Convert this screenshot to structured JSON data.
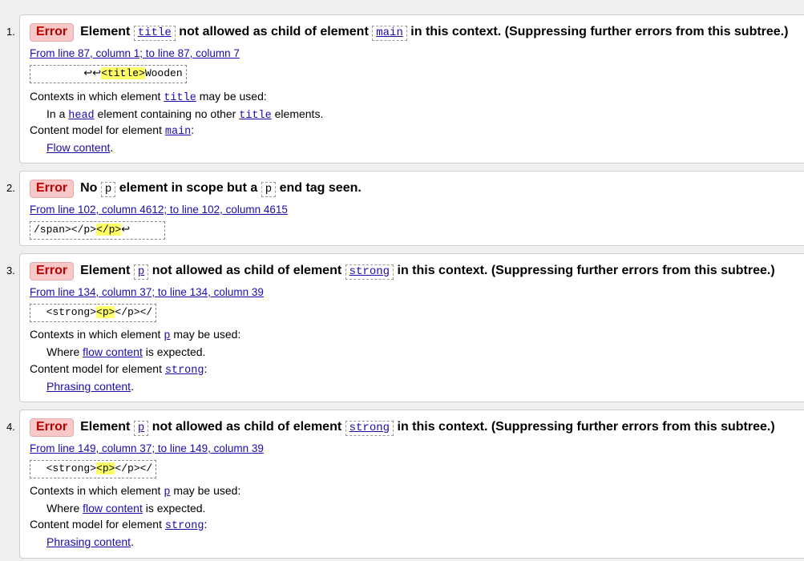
{
  "errors": [
    {
      "num": "1.",
      "badge": "Error",
      "msg": {
        "a": "Element",
        "code1": "title",
        "b": "not allowed as child of element",
        "code2": "main",
        "c": "in this context. (Suppressing further errors from this subtree.)"
      },
      "location": "From line 87, column 1; to line 87, column 7",
      "extract": {
        "pre": "        ↩↩",
        "hl": "<title>",
        "post": "Wooden"
      },
      "ctx_label": {
        "pre": "Contexts in which element",
        "el": "title",
        "post": "may be used:"
      },
      "ctx_value": {
        "pre": "In a",
        "link": "head",
        "post": "element containing no other",
        "el": "title",
        "post2": "elements."
      },
      "cm_label": {
        "pre": "Content model for element",
        "el": "main",
        "post": ":"
      },
      "cm_value": "Flow content",
      "cm_dot": "."
    },
    {
      "num": "2.",
      "badge": "Error",
      "msg": {
        "a": "No",
        "code1": "p",
        "b": "element in scope but a",
        "code2": "p",
        "c": "end tag seen."
      },
      "location": "From line 102, column 4612; to line 102, column 4615",
      "extract": {
        "pre": "/span></p>",
        "hl": "</p>",
        "post": "↩     "
      }
    },
    {
      "num": "3.",
      "badge": "Error",
      "msg": {
        "a": "Element",
        "code1": "p",
        "b": "not allowed as child of element",
        "code2": "strong",
        "c": "in this context. (Suppressing further errors from this subtree.)"
      },
      "location": "From line 134, column 37; to line 134, column 39",
      "extract": {
        "pre": "  <strong>",
        "hl": "<p>",
        "post": "</p></"
      },
      "ctx_label": {
        "pre": "Contexts in which element",
        "el": "p",
        "post": "may be used:"
      },
      "ctx_value": {
        "pre": "Where",
        "link": "flow content",
        "post": "is expected."
      },
      "cm_label": {
        "pre": "Content model for element",
        "el": "strong",
        "post": ":"
      },
      "cm_value": "Phrasing content",
      "cm_dot": "."
    },
    {
      "num": "4.",
      "badge": "Error",
      "msg": {
        "a": "Element",
        "code1": "p",
        "b": "not allowed as child of element",
        "code2": "strong",
        "c": "in this context. (Suppressing further errors from this subtree.)"
      },
      "location": "From line 149, column 37; to line 149, column 39",
      "extract": {
        "pre": "  <strong>",
        "hl": "<p>",
        "post": "</p></"
      },
      "ctx_label": {
        "pre": "Contexts in which element",
        "el": "p",
        "post": "may be used:"
      },
      "ctx_value": {
        "pre": "Where",
        "link": "flow content",
        "post": "is expected."
      },
      "cm_label": {
        "pre": "Content model for element",
        "el": "strong",
        "post": ":"
      },
      "cm_value": "Phrasing content",
      "cm_dot": "."
    }
  ]
}
